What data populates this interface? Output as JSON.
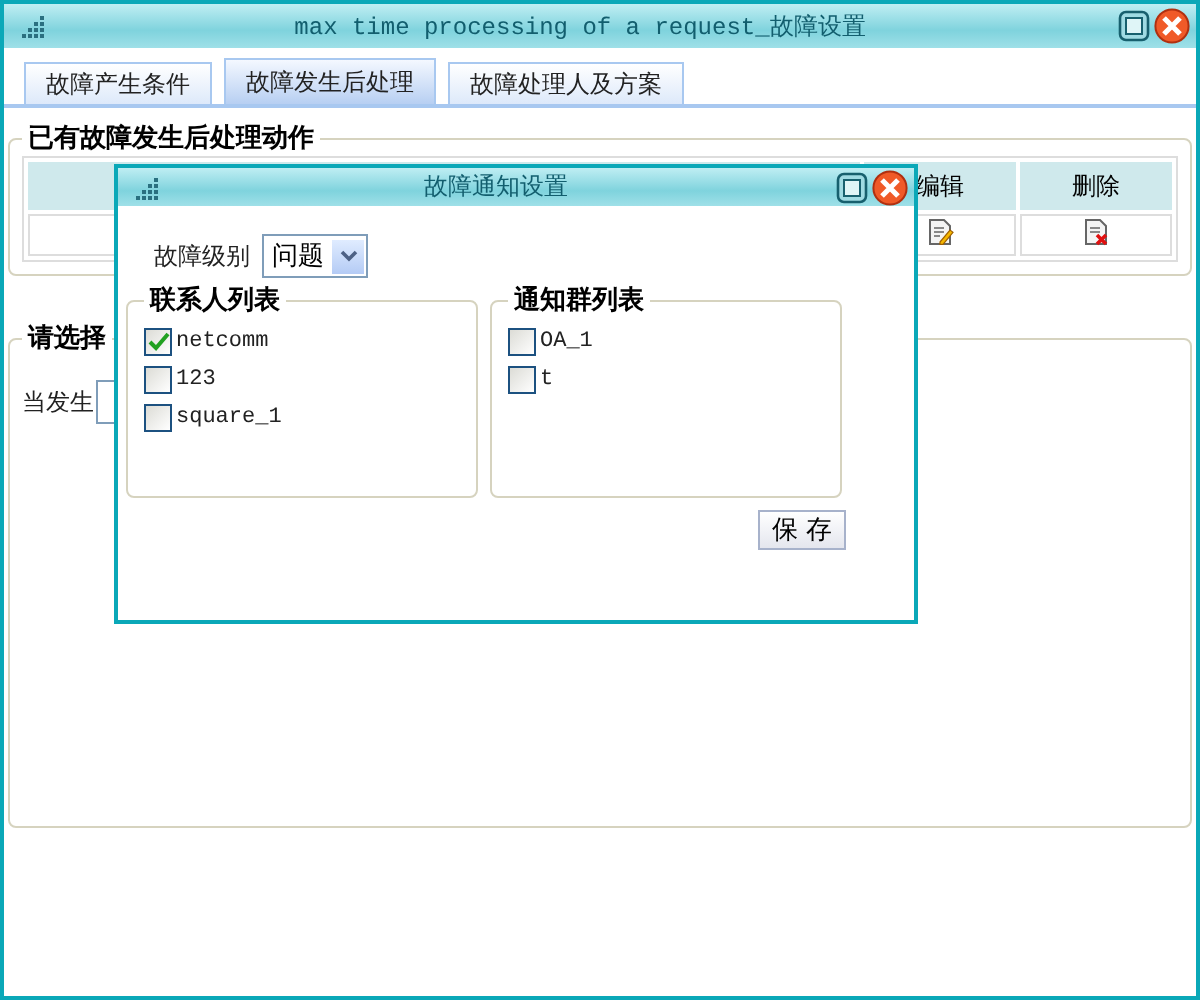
{
  "window": {
    "title": "max time processing of a request_故障设置"
  },
  "tabs": [
    {
      "label": "故障产生条件",
      "selected": false
    },
    {
      "label": "故障发生后处理",
      "selected": true
    },
    {
      "label": "故障处理人及方案",
      "selected": false
    }
  ],
  "actions_section": {
    "legend": "已有故障发生后处理动作",
    "columns": [
      "编辑",
      "删除"
    ]
  },
  "condition_section": {
    "legend": "请选择",
    "label": "当发生"
  },
  "dialog": {
    "title": "故障通知设置",
    "level_label": "故障级别",
    "level_value": "问题",
    "groups": [
      {
        "legend": "联系人列表",
        "items": [
          {
            "label": "netcomm",
            "checked": true
          },
          {
            "label": "123",
            "checked": false
          },
          {
            "label": "square_1",
            "checked": false
          }
        ]
      },
      {
        "legend": "通知群列表",
        "items": [
          {
            "label": "OA_1",
            "checked": false
          },
          {
            "label": "t",
            "checked": false
          }
        ]
      }
    ],
    "save": "保 存"
  }
}
